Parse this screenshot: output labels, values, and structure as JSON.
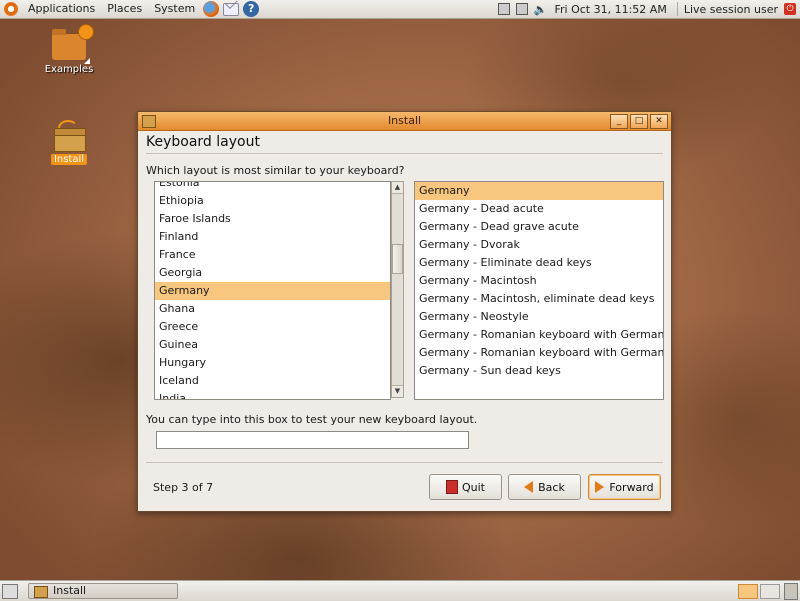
{
  "top_panel": {
    "menus": [
      "Applications",
      "Places",
      "System"
    ],
    "clock": "Fri Oct 31, 11:52 AM",
    "user": "Live session user"
  },
  "desktop": {
    "icons": [
      {
        "label": "Examples"
      },
      {
        "label": "Install"
      }
    ]
  },
  "window": {
    "title": "Install",
    "heading": "Keyboard layout",
    "question": "Which layout is most similar to your keyboard?",
    "countries": [
      "Estonia",
      "Ethiopia",
      "Faroe Islands",
      "Finland",
      "France",
      "Georgia",
      "Germany",
      "Ghana",
      "Greece",
      "Guinea",
      "Hungary",
      "Iceland",
      "India"
    ],
    "selected_country": "Germany",
    "variants": [
      "Germany",
      "Germany - Dead acute",
      "Germany - Dead grave acute",
      "Germany - Dvorak",
      "Germany - Eliminate dead keys",
      "Germany - Macintosh",
      "Germany - Macintosh, eliminate dead keys",
      "Germany - Neostyle",
      "Germany - Romanian keyboard with German letters",
      "Germany - Romanian keyboard with German letters, eliminate dead keys",
      "Germany - Sun dead keys"
    ],
    "selected_variant": "Germany",
    "test_label": "You can type into this box to test your new keyboard layout.",
    "test_value": "",
    "step": "Step 3 of 7",
    "buttons": {
      "quit": "Quit",
      "back": "Back",
      "forward": "Forward"
    }
  },
  "taskbar": {
    "task": "Install"
  },
  "colors": {
    "accent": "#f39418",
    "selection": "#f7c67f",
    "titlebar": "#e4892e"
  }
}
